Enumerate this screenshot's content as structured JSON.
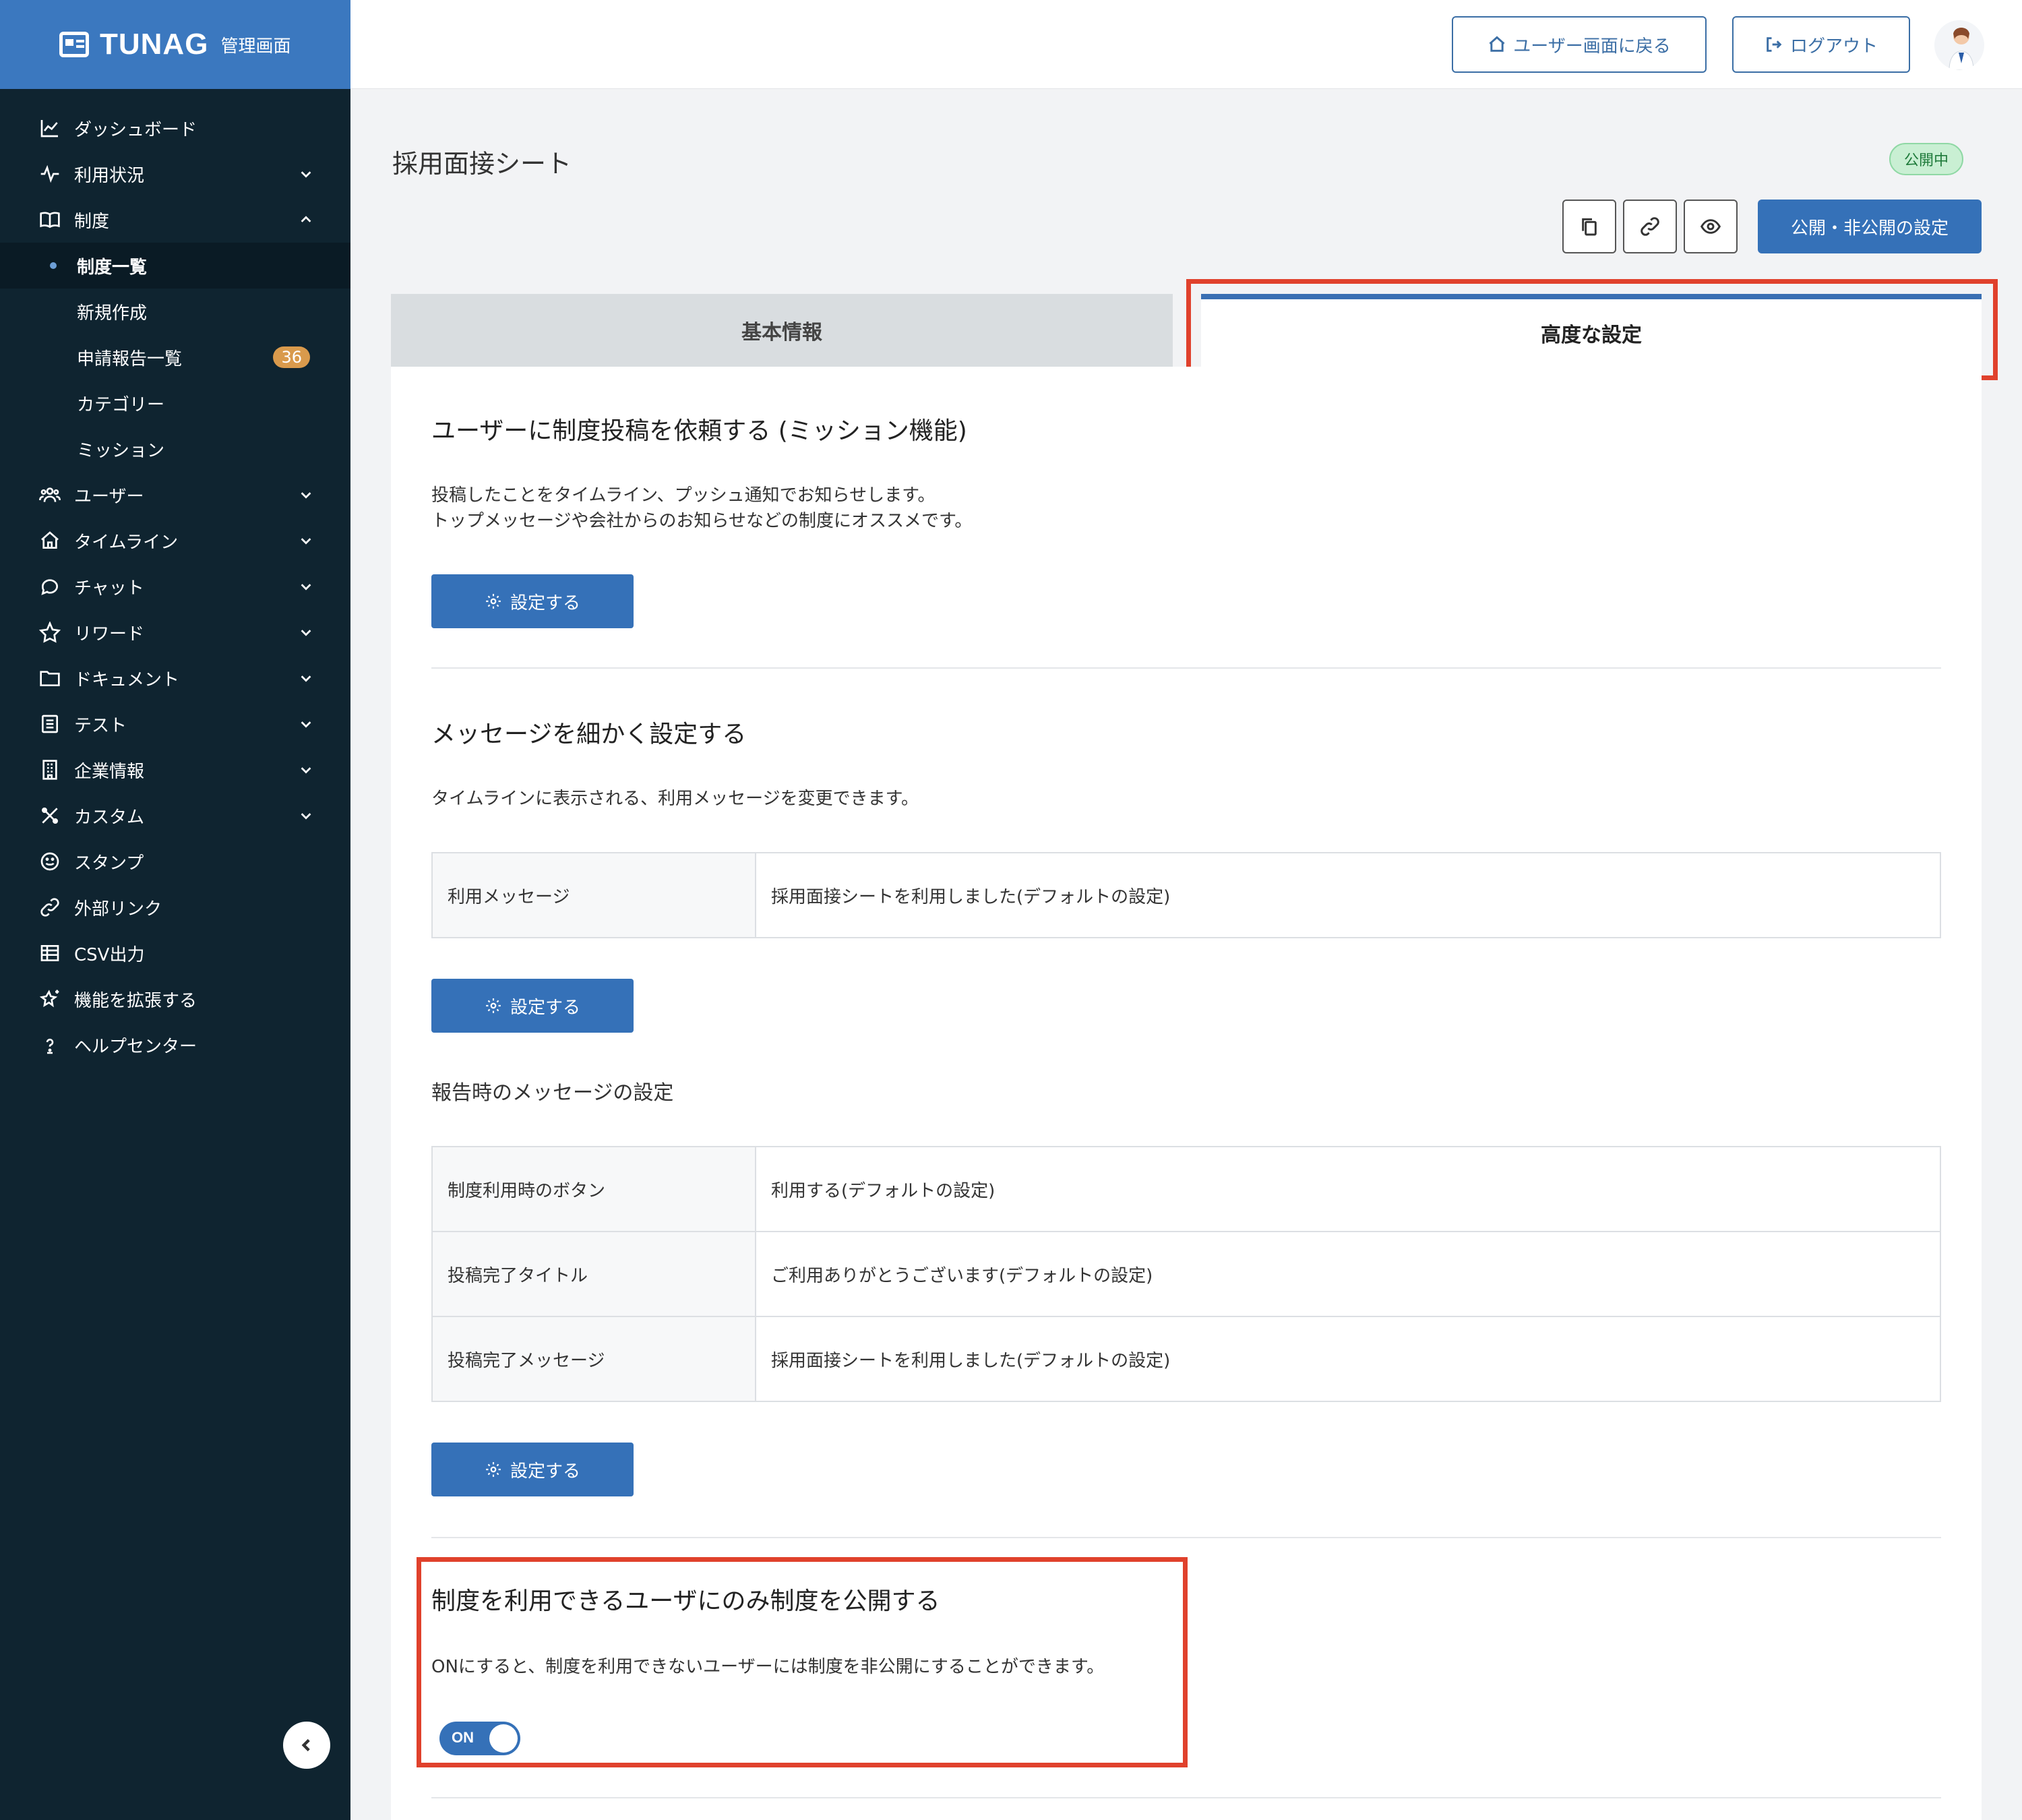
{
  "brand": {
    "name": "TUNAG",
    "subtitle": "管理画面"
  },
  "sidebar": {
    "items": [
      {
        "label": "ダッシュボード",
        "icon": "chart-line-icon",
        "chevron": ""
      },
      {
        "label": "利用状況",
        "icon": "activity-icon",
        "chevron": "down"
      },
      {
        "label": "制度",
        "icon": "book-icon",
        "chevron": "up"
      },
      {
        "label": "ユーザー",
        "icon": "users-icon",
        "chevron": "down"
      },
      {
        "label": "タイムライン",
        "icon": "home-icon",
        "chevron": "down"
      },
      {
        "label": "チャット",
        "icon": "chat-bubble-icon",
        "chevron": "down"
      },
      {
        "label": "リワード",
        "icon": "star-icon",
        "chevron": "down"
      },
      {
        "label": "ドキュメント",
        "icon": "folder-icon",
        "chevron": "down"
      },
      {
        "label": "テスト",
        "icon": "checklist-icon",
        "chevron": "down"
      },
      {
        "label": "企業情報",
        "icon": "building-icon",
        "chevron": "down"
      },
      {
        "label": "カスタム",
        "icon": "tools-icon",
        "chevron": "down"
      },
      {
        "label": "スタンプ",
        "icon": "smile-icon",
        "chevron": ""
      },
      {
        "label": "外部リンク",
        "icon": "link-icon",
        "chevron": ""
      },
      {
        "label": "CSV出力",
        "icon": "table-icon",
        "chevron": ""
      },
      {
        "label": "機能を拡張する",
        "icon": "sparkle-star-icon",
        "chevron": ""
      },
      {
        "label": "ヘルプセンター",
        "icon": "help-bulb-icon",
        "chevron": ""
      }
    ],
    "sub_items": [
      {
        "label": "制度一覧",
        "active": true
      },
      {
        "label": "新規作成"
      },
      {
        "label": "申請報告一覧",
        "badge": "36"
      },
      {
        "label": "カテゴリー"
      },
      {
        "label": "ミッション"
      }
    ]
  },
  "header": {
    "back_label": "ユーザー画面に戻る",
    "logout_label": "ログアウト"
  },
  "page": {
    "title": "採用面接シート",
    "status": "公開中",
    "publish_button": "公開・非公開の設定",
    "tabs": [
      {
        "label": "基本情報",
        "active": false
      },
      {
        "label": "高度な設定",
        "active": true
      }
    ]
  },
  "mission": {
    "title": "ユーザーに制度投稿を依頼する (ミッション機能)",
    "desc_line1": "投稿したことをタイムライン、プッシュ通知でお知らせします。",
    "desc_line2": "トップメッセージや会社からのお知らせなどの制度にオススメです。",
    "button": "設定する"
  },
  "message": {
    "title": "メッセージを細かく設定する",
    "desc": "タイムラインに表示される、利用メッセージを変更できます。",
    "rows": [
      {
        "key": "利用メッセージ",
        "value": "採用面接シートを利用しました(デフォルトの設定)"
      }
    ],
    "button": "設定する"
  },
  "report": {
    "title": "報告時のメッセージの設定",
    "rows": [
      {
        "key": "制度利用時のボタン",
        "value": "利用する(デフォルトの設定)"
      },
      {
        "key": "投稿完了タイトル",
        "value": "ご利用ありがとうございます(デフォルトの設定)"
      },
      {
        "key": "投稿完了メッセージ",
        "value": "採用面接シートを利用しました(デフォルトの設定)"
      }
    ],
    "button": "設定する"
  },
  "restrict": {
    "title": "制度を利用できるユーザにのみ制度を公開する",
    "desc": "ONにすると、制度を利用できないユーザーには制度を非公開にすることができます。",
    "toggle_label": "ON",
    "toggle_on": true
  },
  "colors": {
    "sidebar": "#0f2430",
    "brand": "#3b78bf",
    "primary": "#3571b8",
    "highlight": "#e0412c",
    "status_bg": "#c9efd3"
  }
}
